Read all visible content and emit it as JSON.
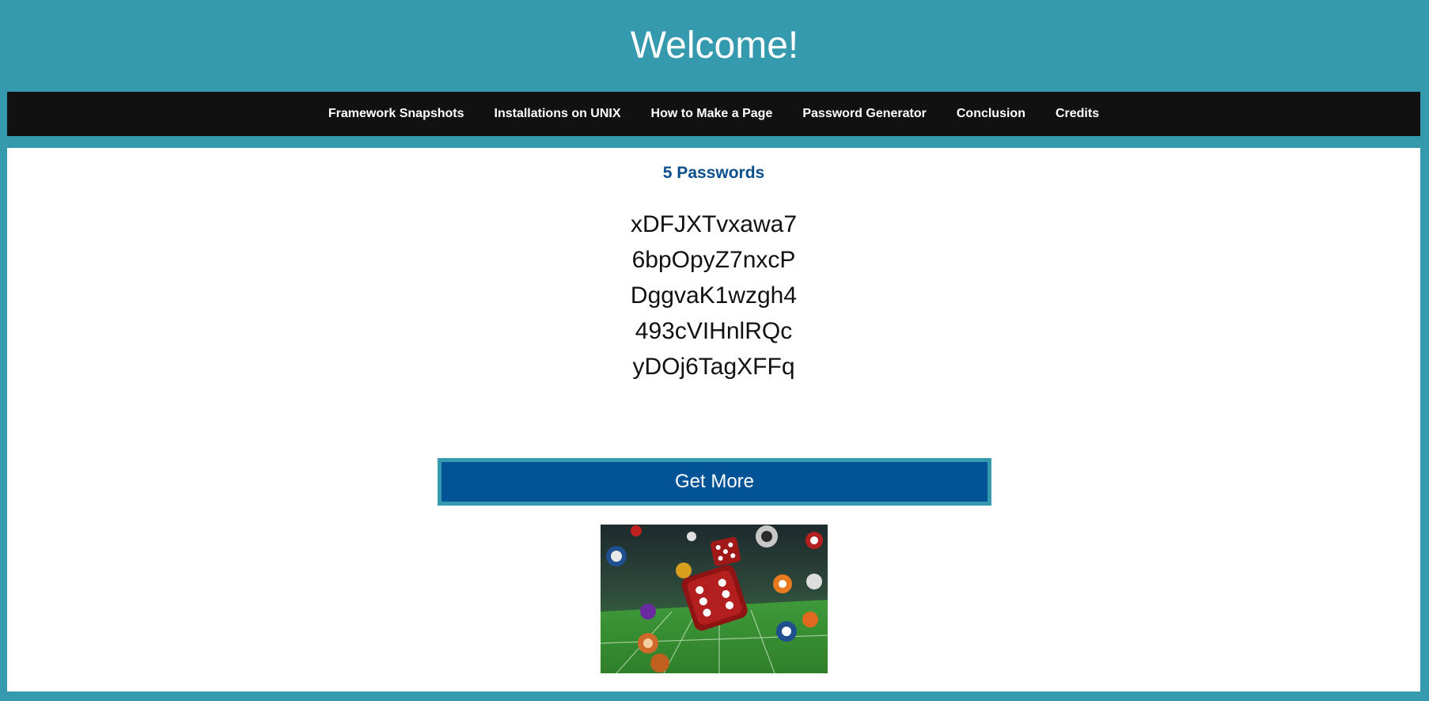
{
  "header": {
    "title": "Welcome!"
  },
  "nav": {
    "items": [
      {
        "label": "Framework Snapshots"
      },
      {
        "label": "Installations on UNIX"
      },
      {
        "label": "How to Make a Page"
      },
      {
        "label": "Password Generator"
      },
      {
        "label": "Conclusion"
      },
      {
        "label": "Credits"
      }
    ]
  },
  "main": {
    "heading": "5 Passwords",
    "passwords": [
      "xDFJXTvxawa7",
      "6bpOpyZ7nxcP",
      "DggvaK1wzgh4",
      "493cVIHnlRQc",
      "yDOj6TagXFFq"
    ],
    "button_label": "Get More",
    "image_icon": "dice-casino-image"
  },
  "colors": {
    "page_bg": "#359aad",
    "nav_bg": "#111111",
    "heading": "#0c4f8c",
    "button_bg": "#035497"
  }
}
